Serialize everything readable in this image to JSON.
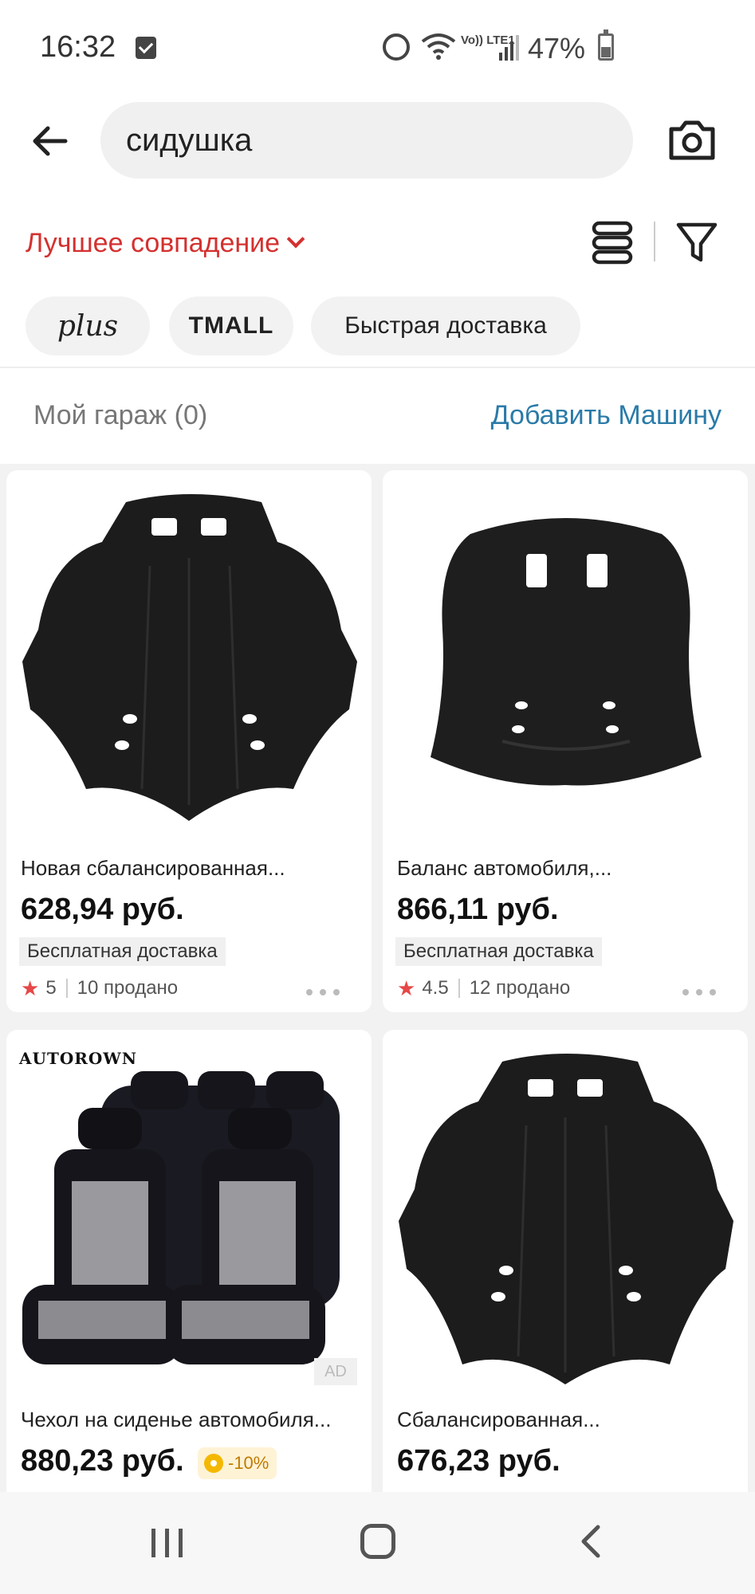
{
  "status_bar": {
    "time": "16:32",
    "network_label": "Vo)) LTE1",
    "battery_percent": "47%"
  },
  "search": {
    "query": "сидушка"
  },
  "sort": {
    "label": "Лучшее совпадение"
  },
  "chips": {
    "plus": "plus",
    "tmall": "TMALL",
    "fast_delivery": "Быстрая доставка"
  },
  "garage": {
    "label": "Мой гараж (0)",
    "add_label": "Добавить Машину"
  },
  "products": [
    {
      "title": "Новая сбалансированная...",
      "price": "628,94 руб.",
      "shipping": "Бесплатная доставка",
      "rating": "5",
      "sold": "10 продано"
    },
    {
      "title": "Баланс автомобиля,...",
      "price": "866,11 руб.",
      "shipping": "Бесплатная доставка",
      "rating": "4.5",
      "sold": "12 продано"
    },
    {
      "title": "Чехол на сиденье автомобиля...",
      "price": "880,23 руб.",
      "discount": "-10%",
      "ad_label": "AD",
      "brand": "AUTOROWN"
    },
    {
      "title": "Сбалансированная...",
      "price": "676,23 руб."
    }
  ],
  "colors": {
    "accent_red": "#d3312f",
    "link_blue": "#2a7ba8",
    "star": "#e64747"
  }
}
